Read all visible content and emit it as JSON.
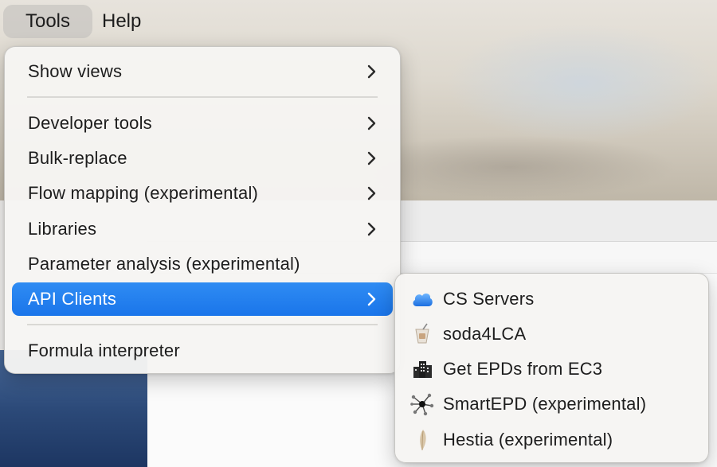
{
  "menubar": {
    "tools_label": "Tools",
    "help_label": "Help"
  },
  "tools_menu": {
    "items": [
      {
        "label": "Show views",
        "submenu": true
      },
      {
        "label": "Developer tools",
        "submenu": true
      },
      {
        "label": "Bulk-replace",
        "submenu": true
      },
      {
        "label": "Flow mapping (experimental)",
        "submenu": true
      },
      {
        "label": "Libraries",
        "submenu": true
      },
      {
        "label": "Parameter analysis (experimental)",
        "submenu": false
      },
      {
        "label": "API Clients",
        "submenu": true,
        "highlighted": true
      },
      {
        "label": "Formula interpreter",
        "submenu": false
      }
    ],
    "highlight_color": "#1f7cef"
  },
  "api_clients_menu": {
    "items": [
      {
        "label": "CS Servers",
        "icon": "cloud-icon"
      },
      {
        "label": "soda4LCA",
        "icon": "soda-cup-icon"
      },
      {
        "label": "Get EPDs from EC3",
        "icon": "buildings-icon"
      },
      {
        "label": "SmartEPD (experimental)",
        "icon": "network-nodes-icon"
      },
      {
        "label": "Hestia (experimental)",
        "icon": "leaf-feather-icon"
      }
    ]
  }
}
